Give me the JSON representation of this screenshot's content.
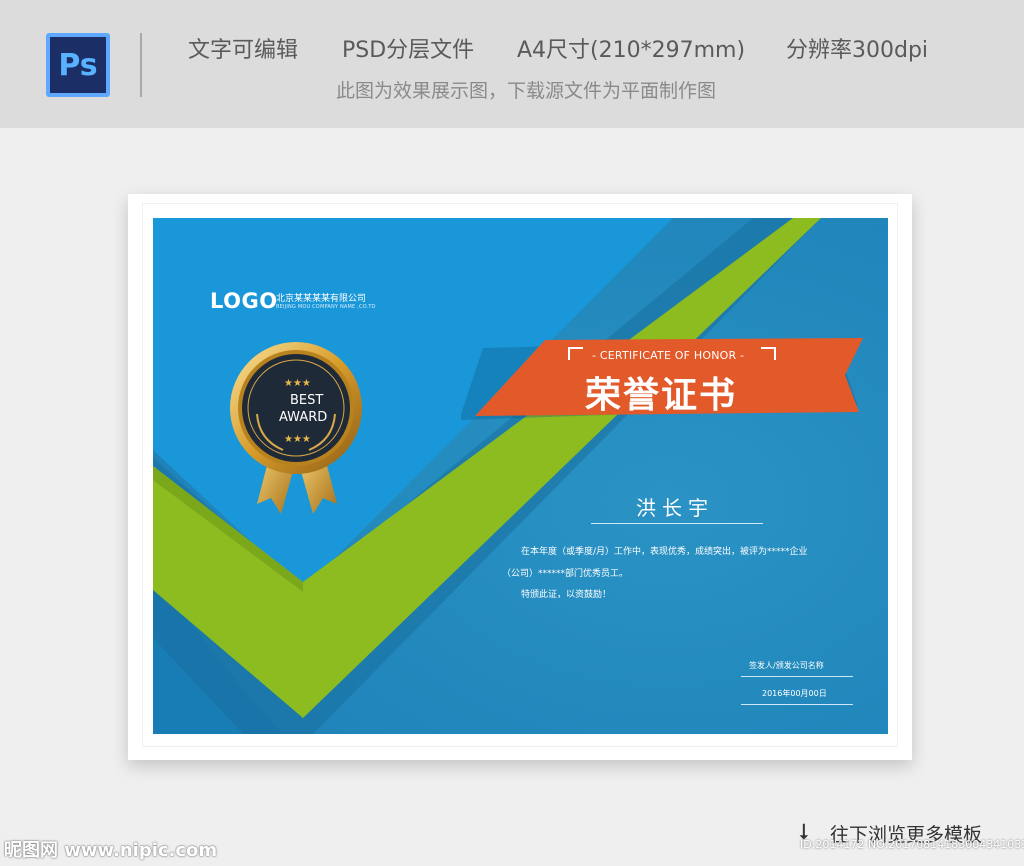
{
  "header": {
    "ps_icon_label": "Ps",
    "features": [
      "文字可编辑",
      "PSD分层文件",
      "A4尺寸(210*297mm)",
      "分辨率300dpi"
    ],
    "note": "此图为效果展示图，下载源文件为平面制作图"
  },
  "certificate": {
    "logo": "LOGO",
    "company_cn": "北京某某某某有限公司",
    "company_en": "BEIJING MOU COMPANY NAME ,CO.TD",
    "ribbon_en": "- CERTIFICATE OF HONOR -",
    "ribbon_cn": "荣誉证书",
    "medal_line1": "BEST",
    "medal_line2": "AWARD",
    "recipient": "洪长宇",
    "body_line1": "在本年度（或季度/月）工作中，表现优秀，成绩突出，被评为*****企业",
    "body_line2": "（公司）******部门优秀员工。",
    "body_line3": "特颁此证，以资鼓励！",
    "signer": "签发人/颁发公司名称",
    "date": "2016年00月00日"
  },
  "footer": {
    "watermark_left": "昵图网 www.nipic.com",
    "watermark_right": "ID:2014172 NO:20170814183004341033",
    "browse_label": "往下浏览更多模板"
  },
  "colors": {
    "cert_blue": "#1f8fc8",
    "light_blue": "#1899da",
    "green": "#8bbb21",
    "ribbon_orange": "#e2592a",
    "medal_dark": "#1f2a38",
    "gold": "#e2b54a"
  }
}
